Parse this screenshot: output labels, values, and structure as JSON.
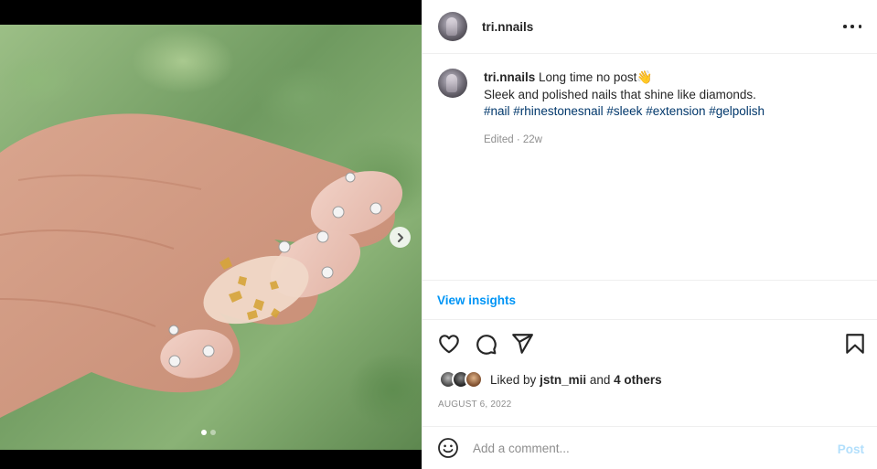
{
  "post": {
    "username": "tri.nnails",
    "more_icon": "more-options-icon"
  },
  "caption": {
    "username": "tri.nnails",
    "first_line": "Long time no post",
    "emoji": "👋",
    "second_line": "Sleek and polished nails that shine like diamonds.",
    "hashtags": [
      "#nail",
      "#rhinestonesnail",
      "#sleek",
      "#extension",
      "#gelpolish"
    ],
    "edited": "Edited",
    "separator": "·",
    "age": "22w"
  },
  "insights": {
    "label": "View insights"
  },
  "actions": {
    "like_icon": "heart-icon",
    "comment_icon": "comment-icon",
    "share_icon": "share-icon",
    "save_icon": "bookmark-icon"
  },
  "likes": {
    "prefix": "Liked by",
    "user": "jstn_mii",
    "conj": "and",
    "others": "4 others"
  },
  "date": "AUGUST 6, 2022",
  "comment": {
    "placeholder": "Add a comment...",
    "post_label": "Post",
    "emoji_icon": "emoji-icon"
  },
  "carousel": {
    "total_slides": 2,
    "current_slide": 1
  },
  "colors": {
    "link": "#00376b",
    "accent": "#0095f6",
    "post_disabled": "#b2dffc",
    "muted": "#8e8e8e"
  }
}
